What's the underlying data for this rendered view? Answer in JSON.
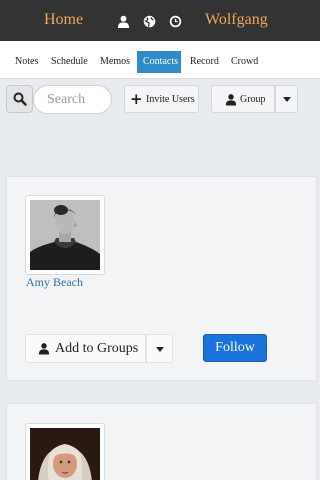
{
  "topbar": {
    "home": "Home",
    "user_name": "Wolfgang",
    "icons": [
      "user-icon",
      "globe-icon",
      "clock-icon"
    ],
    "text_color": "#f0a85a",
    "bg_color": "#333333"
  },
  "tabs": [
    {
      "label": "Notes",
      "active": false
    },
    {
      "label": "Schedule",
      "active": false
    },
    {
      "label": "Memos",
      "active": false
    },
    {
      "label": "Contacts",
      "active": true
    },
    {
      "label": "Record",
      "active": false
    },
    {
      "label": "Crowd",
      "active": false
    }
  ],
  "toolbar": {
    "search_placeholder": "Search",
    "search_value": "",
    "invite_label": "Invite Users",
    "group_label": "Group"
  },
  "contacts": [
    {
      "name": "Amy Beach",
      "add_to_groups_label": "Add to Groups",
      "follow_label": "Follow"
    },
    {
      "name": ""
    }
  ],
  "colors": {
    "accent": "#2e8ccb",
    "follow": "#1a72dc",
    "link": "#2b70b8",
    "page_bg": "#e8ebee"
  }
}
